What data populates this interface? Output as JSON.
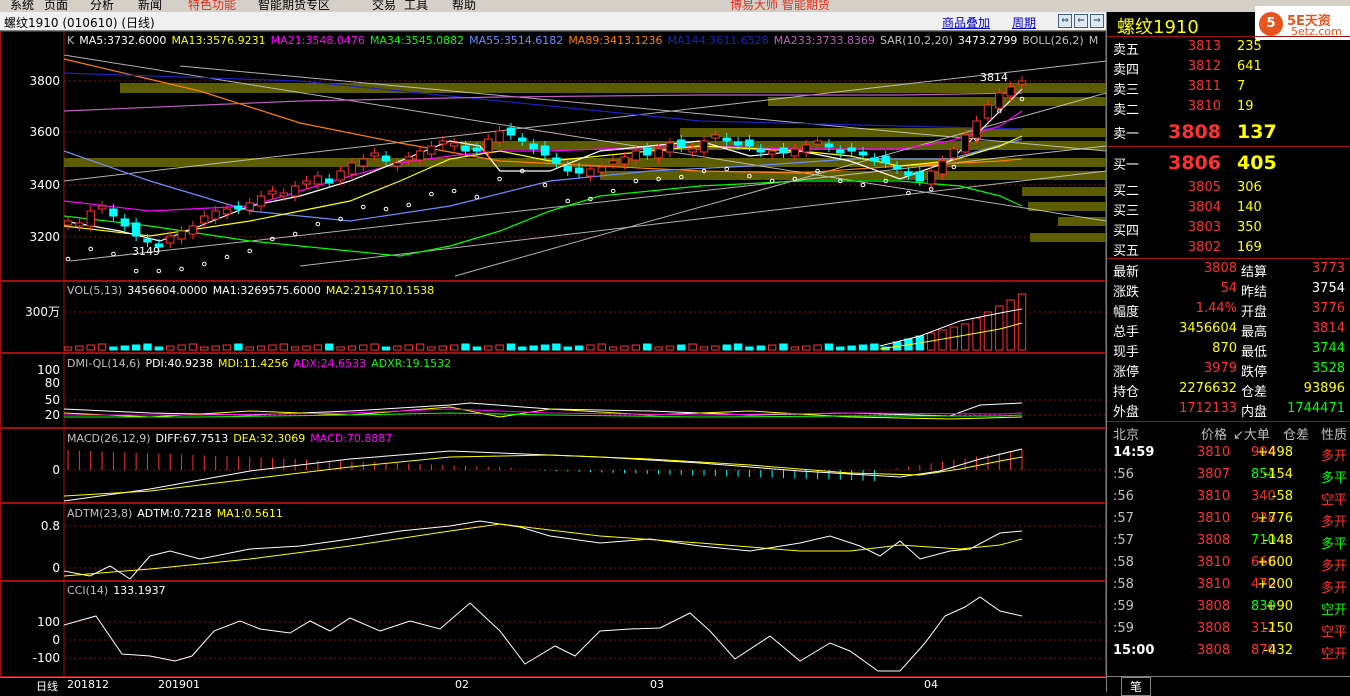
{
  "menu": {
    "items": [
      "系统",
      "页面",
      "分析",
      "新闻",
      "特色功能",
      "智能期货专区",
      "交易",
      "工具",
      "帮助"
    ],
    "ad": "博易大师 智能期货"
  },
  "window": {
    "title": "螺纹1910 (010610) (日线)",
    "link_overlay": "商品叠加",
    "link_period": "周期"
  },
  "main_panel": {
    "indicator_line": [
      {
        "text": "K",
        "color": "#c0c0c0"
      },
      {
        "text": "MA5:3732.6000",
        "color": "#ffffff"
      },
      {
        "text": "MA13:3576.9231",
        "color": "#ffff00"
      },
      {
        "text": "MA21:3548.0476",
        "color": "#ff00ff"
      },
      {
        "text": "MA34:3545.0882",
        "color": "#00ff00"
      },
      {
        "text": "MA55:3514.6182",
        "color": "#6d8dff"
      },
      {
        "text": "MA89:3413.1236",
        "color": "#ff8000"
      },
      {
        "text": "MA144:3611.6528",
        "color": "#2020c0"
      },
      {
        "text": "MA233:3733.8369",
        "color": "#c060c0"
      },
      {
        "text": "SAR(10,2,20)",
        "color": "#c0c0c0"
      },
      {
        "text": "3473.2799",
        "color": "#ffffff"
      },
      {
        "text": "BOLL(26,2)",
        "color": "#c0c0c0"
      },
      {
        "text": "M",
        "color": "#c0c0c0"
      }
    ],
    "y_ticks": [
      "3800",
      "3600",
      "3400",
      "3200"
    ],
    "high_label": "3814",
    "low_label": "3149"
  },
  "vol_panel": {
    "indicator_line": [
      {
        "text": "VOL(5,13)",
        "color": "#c0c0c0"
      },
      {
        "text": "3456604.0000",
        "color": "#ffffff"
      },
      {
        "text": "MA1:3269575.6000",
        "color": "#ffffff"
      },
      {
        "text": "MA2:2154710.1538",
        "color": "#ffff00"
      }
    ],
    "y_ticks": [
      "300万"
    ]
  },
  "dmi_panel": {
    "indicator_line": [
      {
        "text": "DMI-QL(14,6)",
        "color": "#c0c0c0"
      },
      {
        "text": "PDI:40.9238",
        "color": "#ffffff"
      },
      {
        "text": "MDI:11.4256",
        "color": "#ffff00"
      },
      {
        "text": "ADX:24.6533",
        "color": "#ff00ff"
      },
      {
        "text": "ADXR:19.1532",
        "color": "#00ff00"
      }
    ],
    "y_ticks": [
      "100",
      "80",
      "50",
      "20"
    ]
  },
  "macd_panel": {
    "indicator_line": [
      {
        "text": "MACD(26,12,9)",
        "color": "#c0c0c0"
      },
      {
        "text": "DIFF:67.7513",
        "color": "#ffffff"
      },
      {
        "text": "DEA:32.3069",
        "color": "#ffff00"
      },
      {
        "text": "MACD:70.8887",
        "color": "#ff00ff"
      }
    ],
    "y_ticks": [
      "0"
    ]
  },
  "adtm_panel": {
    "indicator_line": [
      {
        "text": "ADTM(23,8)",
        "color": "#c0c0c0"
      },
      {
        "text": "ADTM:0.7218",
        "color": "#ffffff"
      },
      {
        "text": "MA1:0.5611",
        "color": "#ffff00"
      }
    ],
    "y_ticks": [
      "0.8",
      "0"
    ]
  },
  "cci_panel": {
    "indicator_line": [
      {
        "text": "CCI(14)",
        "color": "#c0c0c0"
      },
      {
        "text": "133.1937",
        "color": "#ffffff"
      }
    ],
    "y_ticks": [
      "100",
      "0",
      "-100"
    ]
  },
  "x_axis": {
    "period_label": "日线",
    "labels": [
      "201812",
      "201901",
      "02",
      "03",
      "04"
    ]
  },
  "quote": {
    "symbol": "螺纹1910",
    "logo_text": "5E天资",
    "logo_sub": "5etz.com",
    "asks": [
      {
        "label": "卖五",
        "price": "3813",
        "vol": "235"
      },
      {
        "label": "卖四",
        "price": "3812",
        "vol": "641"
      },
      {
        "label": "卖三",
        "price": "3811",
        "vol": "7"
      },
      {
        "label": "卖二",
        "price": "3810",
        "vol": "19"
      },
      {
        "label": "卖一",
        "price": "3808",
        "vol": "137"
      }
    ],
    "bids": [
      {
        "label": "买一",
        "price": "3806",
        "vol": "405"
      },
      {
        "label": "买二",
        "price": "3805",
        "vol": "306"
      },
      {
        "label": "买三",
        "price": "3804",
        "vol": "140"
      },
      {
        "label": "买四",
        "price": "3803",
        "vol": "350"
      },
      {
        "label": "买五",
        "price": "3802",
        "vol": "169"
      }
    ],
    "stats": [
      {
        "l1": "最新",
        "v1": "3808",
        "c1": "#ff3030",
        "l2": "结算",
        "v2": "3773",
        "c2": "#ff3030"
      },
      {
        "l1": "涨跌",
        "v1": "54",
        "c1": "#ff3030",
        "l2": "昨结",
        "v2": "3754",
        "c2": "#ffffff"
      },
      {
        "l1": "幅度",
        "v1": "1.44%",
        "c1": "#ff3030",
        "l2": "开盘",
        "v2": "3776",
        "c2": "#ff3030"
      },
      {
        "l1": "总手",
        "v1": "3456604",
        "c1": "#ffff00",
        "l2": "最高",
        "v2": "3814",
        "c2": "#ff3030"
      },
      {
        "l1": "现手",
        "v1": "870",
        "c1": "#ffff00",
        "l2": "最低",
        "v2": "3744",
        "c2": "#00ff00"
      },
      {
        "l1": "涨停",
        "v1": "3979",
        "c1": "#ff3030",
        "l2": "跌停",
        "v2": "3528",
        "c2": "#00ff00"
      },
      {
        "l1": "持仓",
        "v1": "2276632",
        "c1": "#ffff00",
        "l2": "仓差",
        "v2": "93896",
        "c2": "#ffff00"
      },
      {
        "l1": "外盘",
        "v1": "1712133",
        "c1": "#ff3030",
        "l2": "内盘",
        "v2": "1744471",
        "c2": "#00ff00"
      }
    ],
    "tick_header": {
      "loc": "北京",
      "price": "价格",
      "big": "↙大单",
      "oi": "仓差",
      "nature": "性质"
    },
    "ticks": [
      {
        "time": "14:59",
        "price": "3810",
        "vol": "904",
        "oi": "+498",
        "nature": "多开",
        "nc": "#ff3030"
      },
      {
        "time": ":56",
        "price": "3807",
        "vol": "854",
        "oi": "-154",
        "nature": "多平",
        "nc": "#00ff00"
      },
      {
        "time": ":56",
        "price": "3810",
        "vol": "340",
        "oi": "-58",
        "nature": "空平",
        "nc": "#ff3030"
      },
      {
        "time": ":57",
        "price": "3810",
        "vol": "928",
        "oi": "+776",
        "nature": "多开",
        "nc": "#ff3030"
      },
      {
        "time": ":57",
        "price": "3808",
        "vol": "710",
        "oi": "-148",
        "nature": "多平",
        "nc": "#00ff00"
      },
      {
        "time": ":58",
        "price": "3810",
        "vol": "660",
        "oi": "+600",
        "nature": "多开",
        "nc": "#ff3030"
      },
      {
        "time": ":58",
        "price": "3810",
        "vol": "470",
        "oi": "+200",
        "nature": "多开",
        "nc": "#ff3030"
      },
      {
        "time": ":59",
        "price": "3808",
        "vol": "830",
        "oi": "+90",
        "nature": "空开",
        "nc": "#00ff00"
      },
      {
        "time": ":59",
        "price": "3808",
        "vol": "312",
        "oi": "-150",
        "nature": "空平",
        "nc": "#ff3030"
      },
      {
        "time": "15:00",
        "price": "3808",
        "vol": "870",
        "oi": "-432",
        "nature": "空开",
        "nc": "#ff3030"
      }
    ],
    "bottom_tab": "笔"
  },
  "colors": {
    "up": "#ff3030",
    "down": "#00ffff",
    "panel_border": "#a01010",
    "grid": "#801010"
  }
}
